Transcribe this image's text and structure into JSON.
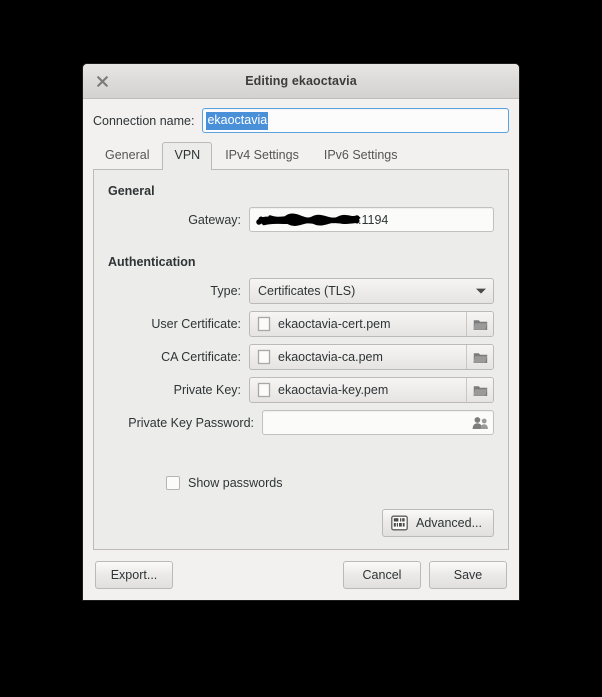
{
  "window": {
    "title": "Editing ekaoctavia",
    "close_icon": "close-icon"
  },
  "connection_name": {
    "label": "Connection name:",
    "value": "ekaoctavia"
  },
  "tabs": [
    {
      "label": "General",
      "active": false
    },
    {
      "label": "VPN",
      "active": true
    },
    {
      "label": "IPv4 Settings",
      "active": false
    },
    {
      "label": "IPv6 Settings",
      "active": false
    }
  ],
  "vpn": {
    "general": {
      "title": "General",
      "gateway": {
        "label": "Gateway:",
        "redacted": true,
        "value_visible": ":1194"
      }
    },
    "authentication": {
      "title": "Authentication",
      "type": {
        "label": "Type:",
        "value": "Certificates (TLS)",
        "arrow_icon": "chevron-down-icon"
      },
      "user_certificate": {
        "label": "User Certificate:",
        "value": "ekaoctavia-cert.pem",
        "file_icon": "file-icon",
        "browse_icon": "folder-icon"
      },
      "ca_certificate": {
        "label": "CA Certificate:",
        "value": "ekaoctavia-ca.pem",
        "file_icon": "file-icon",
        "browse_icon": "folder-icon"
      },
      "private_key": {
        "label": "Private Key:",
        "value": "ekaoctavia-key.pem",
        "file_icon": "file-icon",
        "browse_icon": "folder-icon"
      },
      "private_key_password": {
        "label": "Private Key Password:",
        "value": "",
        "placeholder": "",
        "store_icon": "users-icon"
      }
    },
    "show_passwords": {
      "label": "Show passwords",
      "checked": false
    },
    "advanced_button": {
      "label": "Advanced...",
      "icon": "preferences-icon"
    }
  },
  "actions": {
    "export": "Export...",
    "cancel": "Cancel",
    "save": "Save"
  },
  "colors": {
    "selection": "#4a90d9",
    "focus_border": "#5aa3e0",
    "dialog_bg": "#f2f1f0",
    "content_bg": "#ececea",
    "text": "#2e3436",
    "backdrop": "#000000"
  }
}
